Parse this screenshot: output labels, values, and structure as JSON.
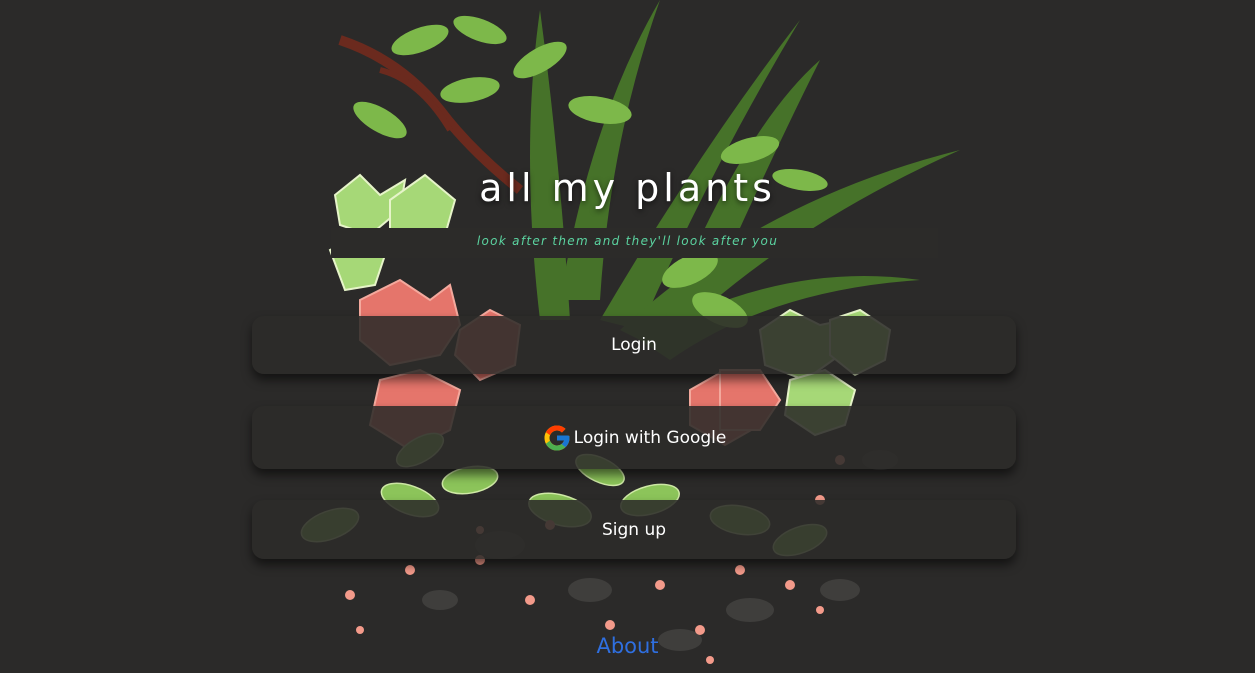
{
  "app": {
    "title": "all my plants",
    "tagline": "look after them and they'll look after you"
  },
  "buttons": {
    "login_label": "Login",
    "google_label": "Login with Google",
    "signup_label": "Sign up"
  },
  "footer": {
    "about_label": "About"
  },
  "icons": {
    "google": "google-icon"
  },
  "colors": {
    "background": "#2b2a29",
    "tagline": "#5bd3a0",
    "about_link": "#2f6fe0",
    "button_bg": "#2c2b29",
    "text": "#ffffff"
  }
}
